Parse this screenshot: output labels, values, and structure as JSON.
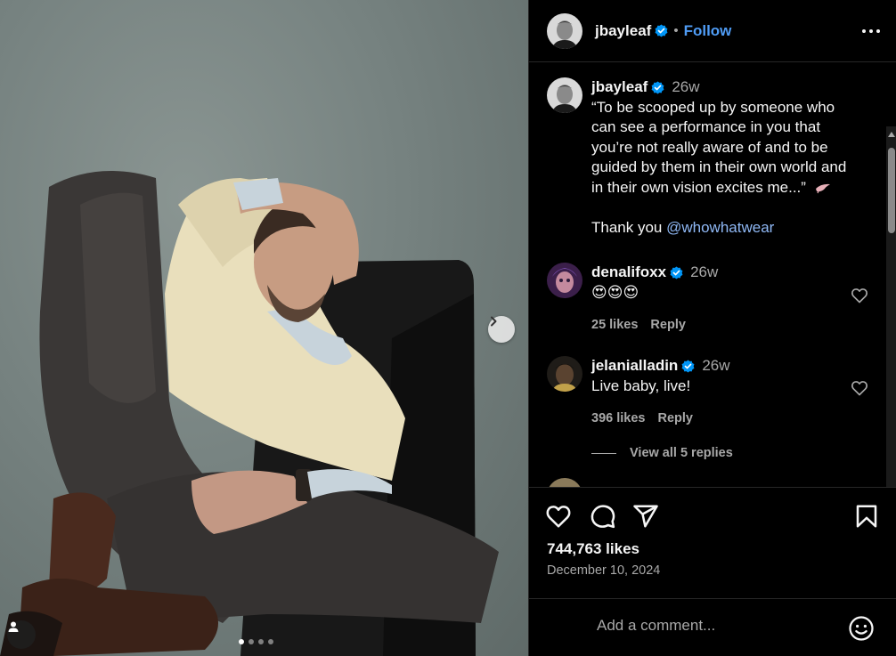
{
  "post": {
    "author": "jbayleaf",
    "follow_label": "Follow",
    "separator": "•",
    "caption_age": "26w",
    "caption_lines": [
      "“To be scooped up by someone who",
      "can see a performance in you that",
      "you’re not really aware of and to be",
      "guided by them in their own world and",
      "in their own vision excites me...”"
    ],
    "caption_thanks": "Thank you ",
    "caption_mention": "@whowhatwear",
    "likes": "744,763 likes",
    "date": "December 10, 2024"
  },
  "comments": [
    {
      "user": "denalifoxx",
      "age": "26w",
      "text": "😍😍😍",
      "likes": "25 likes",
      "reply": "Reply"
    },
    {
      "user": "jelanialladin",
      "age": "26w",
      "text": "Live baby, live!",
      "likes": "396 likes",
      "reply": "Reply",
      "view_replies": "View all 5 replies"
    }
  ],
  "composer": {
    "placeholder": "Add a comment..."
  },
  "carousel": {
    "slides": 4,
    "active": 1
  },
  "icons": [
    "more-icon",
    "verified-badge-icon",
    "heart-icon",
    "comment-icon",
    "share-icon",
    "bookmark-icon",
    "emoji-icon",
    "user-tag-icon",
    "chevron-right-icon"
  ],
  "colors": {
    "accent": "#4f9cf5",
    "verified": "#0095f6",
    "secondary_text": "#a8a8a8",
    "background": "#000000"
  }
}
